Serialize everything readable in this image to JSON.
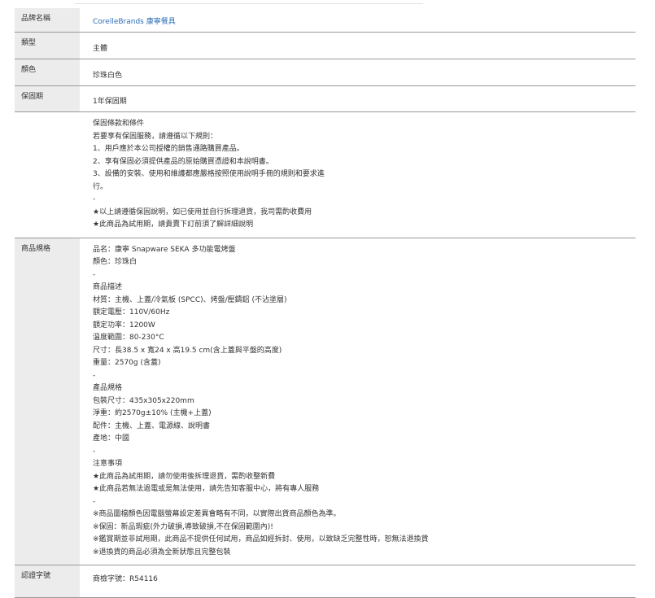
{
  "rows": {
    "product_name": {
      "label": "品牌名稱",
      "value": "CorelleBrands 康寧餐具"
    },
    "type": {
      "label": "類型",
      "value": "主體"
    },
    "color": {
      "label": "顏色",
      "value": "珍珠白色"
    },
    "warranty": {
      "label": "保固期",
      "value": "1年保固期"
    },
    "warranty_terms": {
      "lines": [
        "保固條款和條件",
        "若要享有保固服務，請遵循以下規則：",
        "1、用戶應於本公司授權的銷售通路購買產品。",
        "2、享有保固必須提供產品的原始購買憑證和本說明書。",
        "3、設備的安裝、使用和維護都應嚴格按照使用說明手冊的規則和要求進",
        "行。",
        "-",
        "★以上請遵循保固說明，如已使用並自行拆理退貨，我司需酌收費用",
        "★此商品為試用期，請貴賣下訂前須了解詳細說明"
      ]
    },
    "spec": {
      "label": "商品規格",
      "lines": [
        "品名：康寧 Snapware SEKA 多功能電烤盤",
        "顏色：珍珠白",
        "-",
        "商品描述",
        "材質：主機、上蓋/冷氣板 (SPCC)、烤盤/壓鑄鋁 (不沾塗層)",
        "額定電壓：110V/60Hz",
        "額定功率：1200W",
        "溫度範圍：80-230°C",
        "尺寸：長38.5 x 寬24 x 高19.5 cm(含上蓋與平盤的高度)",
        "重量：2570g (含蓋)",
        "-",
        "產品規格",
        "包裝尺寸：435x305x220mm",
        "淨重：約2570g±10% (主機+上蓋)",
        "配件：主機、上蓋、電源線、說明書",
        "產地：中國",
        "-",
        "注意事項",
        "★此商品為試用期，請勿使用後拆理退貨，需酌收整新費",
        "★此商品若無法過電或是無法使用，請先告知客服中心，將有專人服務",
        "-",
        "※商品圖檔顏色因電腦螢幕設定差異會略有不同，以實際出貨商品顏色為準。",
        "※保固：新品瑕疵(外力破損,導致破損,不在保固範圍內)!",
        "※鑑賞期並非試用期，此商品不提供任何試用，商品如經拆封、使用，以致缺乏完整性時，恕無法退換貨",
        "※退換貨的商品必須為全新狀態且完整包裝"
      ]
    },
    "cert": {
      "label": "認證字號",
      "value": "商檢字號：R54116"
    }
  }
}
